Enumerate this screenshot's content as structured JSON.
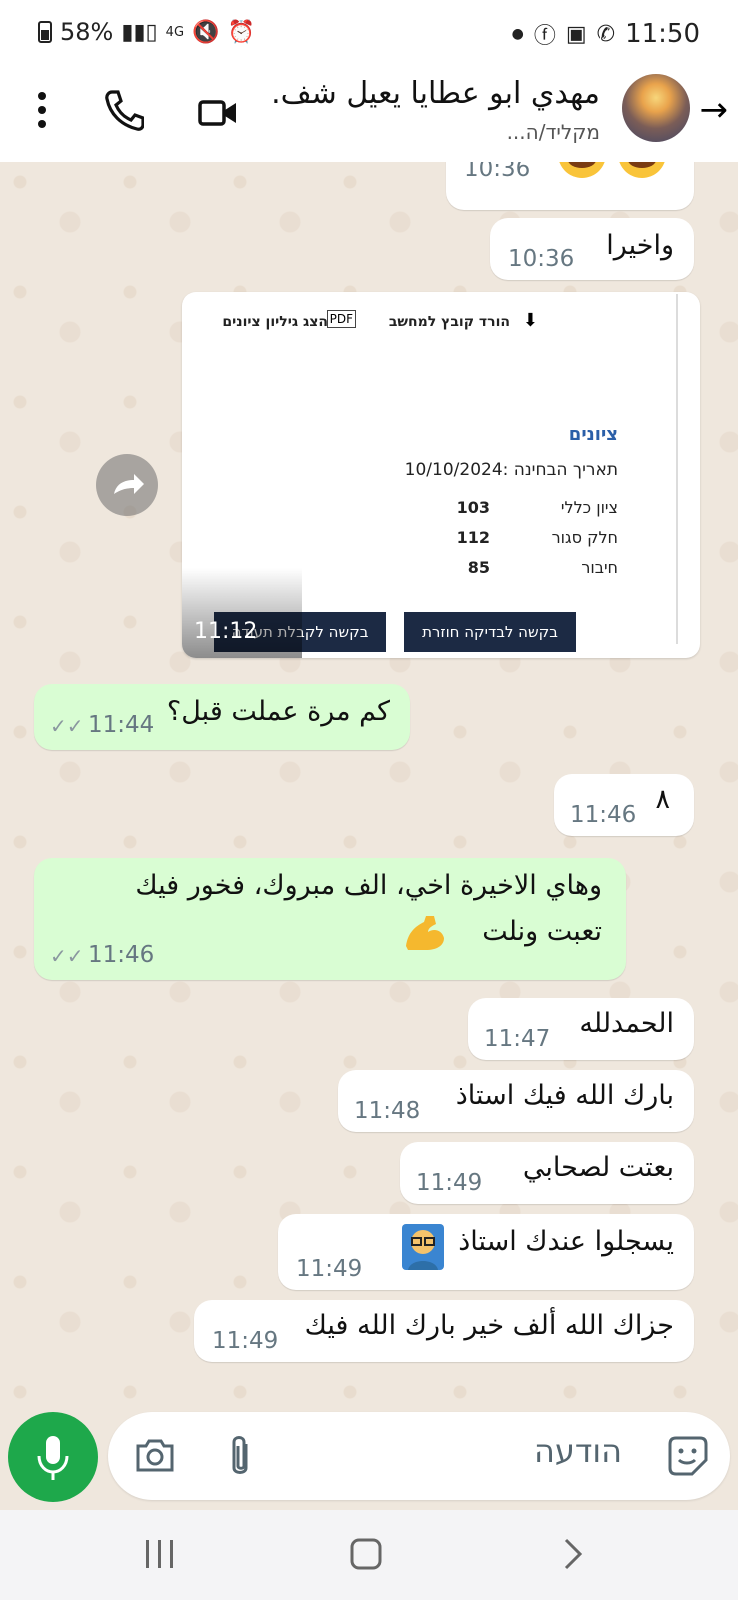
{
  "status": {
    "battery": "58%",
    "network": "4G",
    "time": "11:50"
  },
  "header": {
    "name": "مهدي ابو عطايا يعيل شف.",
    "subtitle": "מקליד/ה..."
  },
  "messages": [
    {
      "dir": "in",
      "text": "",
      "time": "10:36",
      "emoji": "laughing-crying"
    },
    {
      "dir": "in",
      "text": "واخيرا",
      "time": "10:36"
    },
    {
      "dir": "in",
      "type": "image",
      "time": "11:12"
    },
    {
      "dir": "out",
      "text": "كم مرة عملت قبل؟",
      "time": "11:44"
    },
    {
      "dir": "in",
      "text": "٨",
      "time": "11:46"
    },
    {
      "dir": "out",
      "text_line1": "وهاي الاخيرة اخي، الف مبروك، فخور فيك",
      "text_line2": "تعبت ونلت",
      "time": "11:46",
      "emoji": "flexed-biceps"
    },
    {
      "dir": "in",
      "text": "الحمدلله",
      "time": "11:47"
    },
    {
      "dir": "in",
      "text": "بارك الله فيك استاذ",
      "time": "11:48"
    },
    {
      "dir": "in",
      "text": "بعتت لصحابي",
      "time": "11:49"
    },
    {
      "dir": "in",
      "text": "يسجلوا عندك استاذ",
      "time": "11:49",
      "emoji": "teacher"
    },
    {
      "dir": "in",
      "text": "جزاك الله ألف خير بارك الله فيك",
      "time": "11:49"
    }
  ],
  "report": {
    "download_label": "הורד קובץ למחשב",
    "view_label": "הצג גיליון ציונים",
    "heading": "ציונים",
    "exam_date": "תאריך הבחינה :10/10/2024",
    "rows": [
      {
        "label": "ציון כללי",
        "value": "103"
      },
      {
        "label": "חלק סגור",
        "value": "112"
      },
      {
        "label": "חיבור",
        "value": "85"
      }
    ],
    "btn_recheck": "בקשה לבדיקה חוזרת",
    "btn_certificate": "בקשה לקבלת תעודה"
  },
  "composer": {
    "placeholder": "הודעה"
  },
  "colors": {
    "outgoing": "#d9fdd3",
    "incoming": "#ffffff",
    "mic": "#1ea84b",
    "background": "#efe7dd"
  }
}
